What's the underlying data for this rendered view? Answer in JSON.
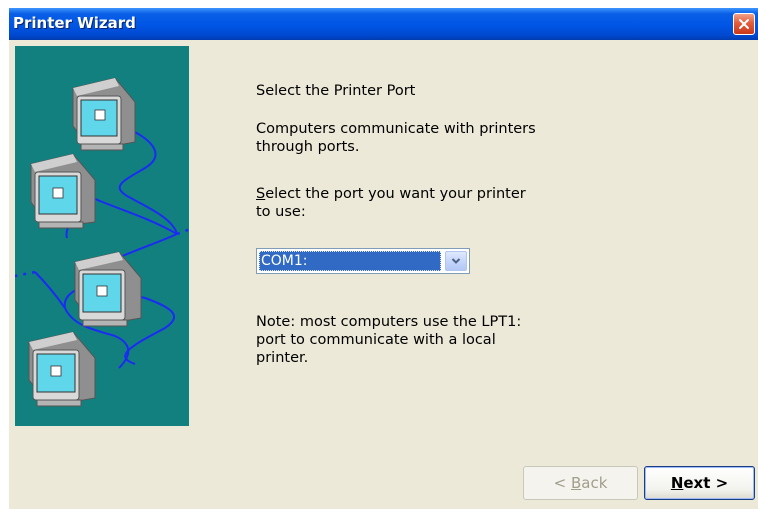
{
  "window": {
    "title": "Printer Wizard"
  },
  "content": {
    "heading": "Select the Printer Port",
    "description_line1": "Computers communicate with printers",
    "description_line2": "through ports.",
    "prompt_line1_accel": "S",
    "prompt_line1_rest": "elect the port you want your printer",
    "prompt_line2": "to use:",
    "port_select_value": "COM1:",
    "note_line1": "Note: most computers use the LPT1:",
    "note_line2": "port to communicate with a local",
    "note_line3": "printer."
  },
  "buttons": {
    "back_prefix": "< ",
    "back_accel": "B",
    "back_rest": "ack",
    "next_accel": "N",
    "next_rest": "ext >"
  },
  "colors": {
    "titlebar": "#0055e5",
    "dialog_bg": "#ece9d8",
    "illustration_bg": "#138080",
    "selection": "#316ac5",
    "close_button": "#e35d3b"
  },
  "icons": [
    "close-icon",
    "chevron-down-icon",
    "computer-network-illustration"
  ]
}
